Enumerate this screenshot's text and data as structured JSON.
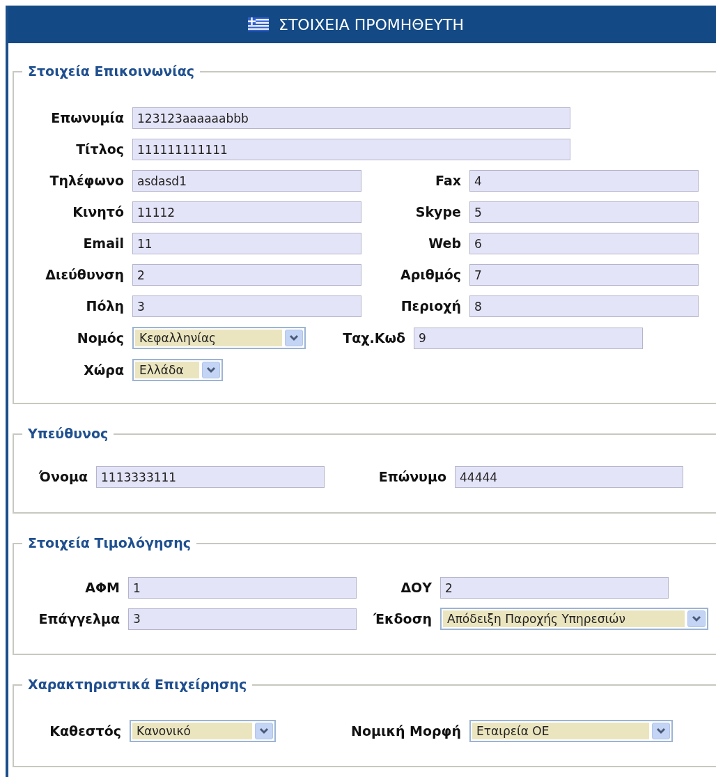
{
  "header": {
    "title": "ΣΤΟΙΧΕΙΑ ΠΡΟΜΗΘΕΥΤΗ"
  },
  "sections": [
    {
      "legend": "Στοιχεία Επικοινωνίας",
      "rows": [
        [
          {
            "label": "Επωνυμία",
            "kind": "text",
            "value": "123123aaaaaabbb"
          }
        ],
        [
          {
            "label": "Τίτλος",
            "kind": "text",
            "value": "111111111111"
          }
        ],
        [
          {
            "label": "Τηλέφωνο",
            "kind": "text",
            "value": "asdasd1"
          },
          {
            "label": "Fax",
            "kind": "text",
            "value": "4"
          }
        ],
        [
          {
            "label": "Κινητό",
            "kind": "text",
            "value": "11112"
          },
          {
            "label": "Skype",
            "kind": "text",
            "value": "5"
          }
        ],
        [
          {
            "label": "Email",
            "kind": "text",
            "value": "11"
          },
          {
            "label": "Web",
            "kind": "text",
            "value": "6"
          }
        ],
        [
          {
            "label": "Διεύθυνση",
            "kind": "text",
            "value": "2"
          },
          {
            "label": "Αριθμός",
            "kind": "text",
            "value": "7"
          }
        ],
        [
          {
            "label": "Πόλη",
            "kind": "text",
            "value": "3"
          },
          {
            "label": "Περιοχή",
            "kind": "text",
            "value": "8"
          }
        ],
        [
          {
            "label": "Νομός",
            "kind": "select",
            "value": "Κεφαλληνίας"
          },
          {
            "label": "Ταχ.Κωδ",
            "kind": "text",
            "value": "9"
          }
        ],
        [
          {
            "label": "Χώρα",
            "kind": "select",
            "value": "Ελλάδα"
          }
        ]
      ]
    },
    {
      "legend": "Υπεύθυνος",
      "rows": [
        [
          {
            "label": "Όνομα",
            "kind": "text",
            "value": "1113333111"
          },
          {
            "label": "Επώνυμο",
            "kind": "text",
            "value": "44444"
          }
        ]
      ]
    },
    {
      "legend": "Στοιχεία Τιμολόγησης",
      "rows": [
        [
          {
            "label": "ΑΦΜ",
            "kind": "text",
            "value": "1"
          },
          {
            "label": "ΔΟΥ",
            "kind": "text",
            "value": "2"
          }
        ],
        [
          {
            "label": "Επάγγελμα",
            "kind": "text",
            "value": "3"
          },
          {
            "label": "Έκδοση",
            "kind": "select",
            "value": "Απόδειξη Παροχής Υπηρεσιών"
          }
        ]
      ]
    },
    {
      "legend": "Χαρακτηριστικά Επιχείρησης",
      "rows": [
        [
          {
            "label": "Καθεστός",
            "kind": "select",
            "value": "Κανονικό"
          },
          {
            "label": "Νομική Μορφή",
            "kind": "select",
            "value": "Εταιρεία ΟΕ"
          }
        ]
      ]
    }
  ]
}
